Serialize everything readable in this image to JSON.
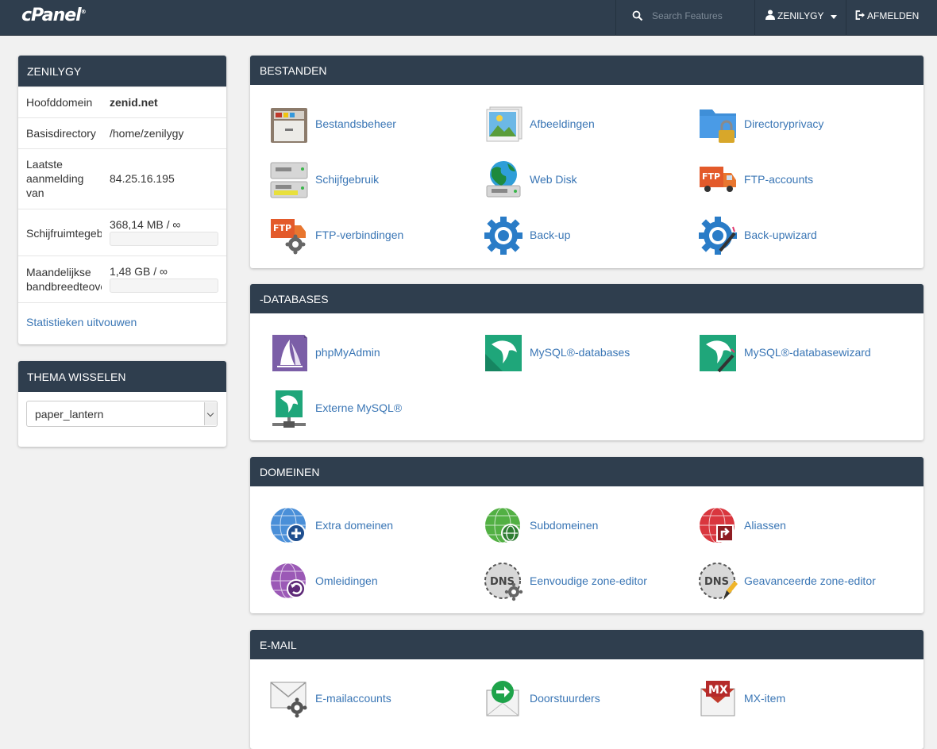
{
  "topbar": {
    "logo": "cPanel",
    "logo_mark": "®",
    "search_placeholder": "Search Features",
    "username": "ZENILYGY",
    "logout": "AFMELDEN"
  },
  "account_panel": {
    "title": "ZENILYGY",
    "rows": [
      {
        "label": "Hoofddomein",
        "value": "zenid.net"
      },
      {
        "label": "Basisdirectory",
        "value": "/home/zenilygy"
      },
      {
        "label_lines": [
          "Laatste",
          "aanmelding",
          "van"
        ],
        "value": "84.25.16.195"
      },
      {
        "label": "Schijfruimtegebruik",
        "value": "368,14 MB / ∞",
        "usage": 0
      },
      {
        "label_lines": [
          "Maandelijkse",
          "bandbreedteoverdracht"
        ],
        "value": "1,48 GB / ∞",
        "usage": 0
      }
    ],
    "stats_link": "Statistieken uitvouwen"
  },
  "theme_panel": {
    "title": "THEMA WISSELEN",
    "selected": "paper_lantern"
  },
  "sections": {
    "files": {
      "title": "BESTANDEN",
      "items": [
        "Bestandsbeheer",
        "Afbeeldingen",
        "Directoryprivacy",
        "Schijfgebruik",
        "Web Disk",
        "FTP-accounts",
        "FTP-verbindingen",
        "Back-up",
        "Back-upwizard"
      ],
      "icons": [
        "file-cabinet-icon",
        "images-icon",
        "folder-lock-icon",
        "disk-usage-icon",
        "web-disk-icon",
        "ftp-truck-icon",
        "ftp-connections-icon",
        "backup-gear-icon",
        "backup-wizard-icon"
      ]
    },
    "databases": {
      "title": "-DATABASES",
      "items": [
        "phpMyAdmin",
        "MySQL®-databases",
        "MySQL®-databasewizard",
        "Externe MySQL®"
      ],
      "icons": [
        "phpmyadmin-sail-icon",
        "mysql-dolphin-icon",
        "mysql-wizard-icon",
        "remote-mysql-icon"
      ]
    },
    "domains": {
      "title": "DOMEINEN",
      "items": [
        "Extra domeinen",
        "Subdomeinen",
        "Aliassen",
        "Omleidingen",
        "Eenvoudige zone-editor",
        "Geavanceerde zone-editor"
      ],
      "icons": [
        "globe-plus-icon",
        "globe-sub-icon",
        "globe-alias-icon",
        "globe-redirect-icon",
        "dns-gear-icon",
        "dns-pencil-icon"
      ]
    },
    "email": {
      "title": "E-MAIL",
      "items": [
        "E-mailaccounts",
        "Doorstuurders",
        "MX-item"
      ],
      "icons": [
        "envelope-gear-icon",
        "envelope-forward-icon",
        "mx-envelope-icon"
      ]
    }
  },
  "colors": {
    "header_bg": "#2f3e4e",
    "link": "#3a76b5",
    "page_bg": "#f1f1f1"
  }
}
